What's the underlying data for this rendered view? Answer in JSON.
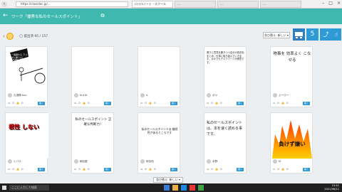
{
  "browser": {
    "url": "https://classdoc.jp/...",
    "tabs": [
      "ロイロノート・スクール",
      "…",
      "…",
      "…"
    ],
    "active_tab": 0
  },
  "appbar": {
    "title": "ワーク「優秀な私のセールスポイント」"
  },
  "subbar": {
    "card_count": "◯ 提出済 95 / 157",
    "sort_label": "並び替え: 新しい ▾"
  },
  "cards": [
    {
      "image_text": "一番頼れる アコギに勝りん！ LEVER",
      "author": "久須郷 Kou",
      "comments": "0",
      "likes": "0"
    },
    {
      "image_text": "",
      "author": "Kn1St",
      "comments": "0",
      "likes": "0"
    },
    {
      "image_text": "",
      "author": "A",
      "comments": "0",
      "likes": "0"
    },
    {
      "image_text": "周りに意見を聞きつつ自分の役割をまとめ、仕事に取り組んでいきます。なかでもデスクワークが得意です。",
      "author": "ボヤ",
      "comments": "0",
      "likes": "0"
    },
    {
      "image_text": "物事を 効率よく こなせる",
      "author": "ぶーびー",
      "comments": "0",
      "likes": "0"
    },
    {
      "image_text": "根性 しない",
      "author": "ヒバス",
      "comments": "0",
      "likes": "0"
    },
    {
      "image_text": "私のセールスポイント 正確な判断力！",
      "author": "朝目藤",
      "comments": "0",
      "likes": "0"
    },
    {
      "image_text": "私のセールスポイントは 継続性があるところです",
      "author": "阿奈西",
      "comments": "0",
      "likes": "0"
    },
    {
      "image_text": "私のセールスポイントは、本を速く読める事です。",
      "author": "永野",
      "comments": "0",
      "likes": "0"
    },
    {
      "image_text": "負けず嫌い",
      "author": "M",
      "comments": "0",
      "likes": "0"
    }
  ],
  "labels": {
    "read_button": "開く"
  },
  "bottom_sort": "並び替え: 新しい ▾",
  "taskbar": {
    "search_placeholder": "ここに入力して検索",
    "time": "15:41",
    "date": "2021/06/11"
  },
  "colors": {
    "appbar": "#3fb8b0",
    "accent": "#2e9ad6",
    "flame_top": "#ff3a00",
    "flame_bottom": "#ffd000"
  }
}
